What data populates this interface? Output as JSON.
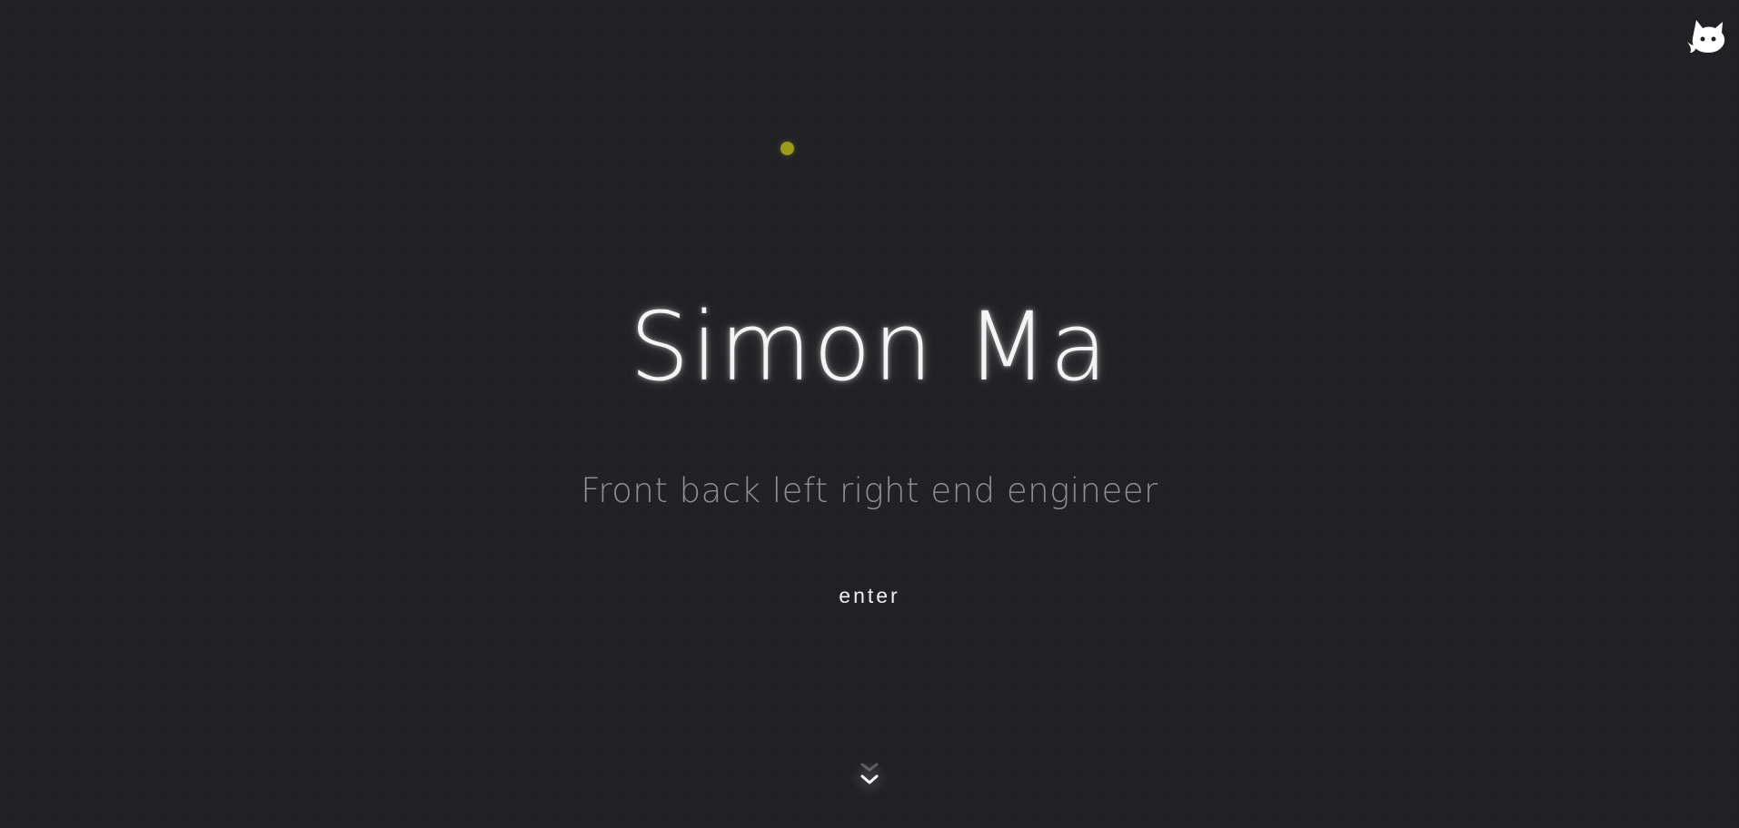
{
  "hero": {
    "name": "Simon Ma",
    "subtitle": "Front back left right end engineer",
    "enter_label": "enter"
  },
  "icons": {
    "corner": "github-cat-icon",
    "scroll": "chevron-down-icon"
  },
  "colors": {
    "background": "#1f2023",
    "dot": "#9c9b1c",
    "name": "#f4f4f4",
    "subtitle": "#8d8f92"
  }
}
